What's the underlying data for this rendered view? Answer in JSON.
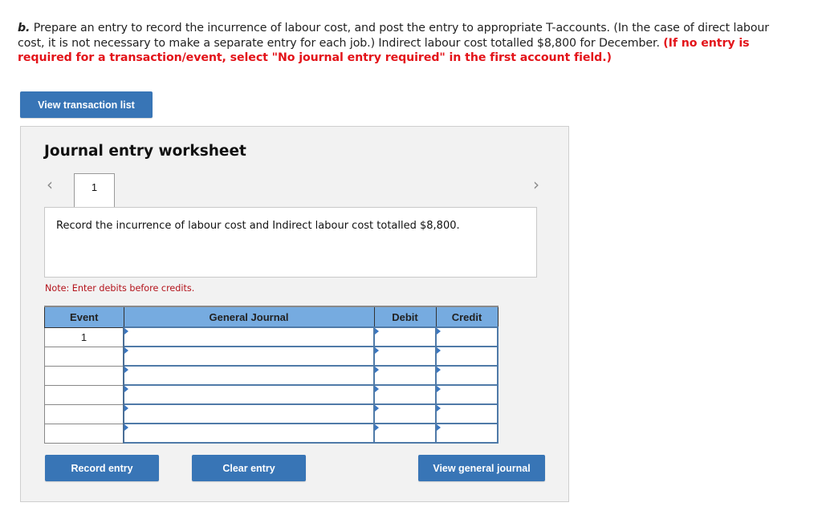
{
  "instructions": {
    "lead": "b.",
    "text": " Prepare an entry to record the incurrence of labour cost, and post the entry to appropriate T-accounts. (In the case of direct labour cost, it is not necessary to make a separate entry for each job.) Indirect labour cost totalled $8,800 for December. ",
    "emphasis": "(If no entry is required for a transaction/event, select \"No journal entry required\" in the first account field.)"
  },
  "buttons": {
    "view_transaction_list": "View transaction list",
    "record_entry": "Record entry",
    "clear_entry": "Clear entry",
    "view_general_journal": "View general journal"
  },
  "worksheet": {
    "title": "Journal entry worksheet",
    "prev_icon": "‹",
    "next_icon": "›",
    "active_tab": "1",
    "description": "Record the incurrence of labour cost and Indirect labour cost totalled $8,800.",
    "note": "Note: Enter debits before credits."
  },
  "table": {
    "headers": {
      "event": "Event",
      "general_journal": "General Journal",
      "debit": "Debit",
      "credit": "Credit"
    },
    "rows": [
      {
        "event": "1",
        "account": "",
        "debit": "",
        "credit": ""
      },
      {
        "event": "",
        "account": "",
        "debit": "",
        "credit": ""
      },
      {
        "event": "",
        "account": "",
        "debit": "",
        "credit": ""
      },
      {
        "event": "",
        "account": "",
        "debit": "",
        "credit": ""
      },
      {
        "event": "",
        "account": "",
        "debit": "",
        "credit": ""
      },
      {
        "event": "",
        "account": "",
        "debit": "",
        "credit": ""
      }
    ]
  }
}
